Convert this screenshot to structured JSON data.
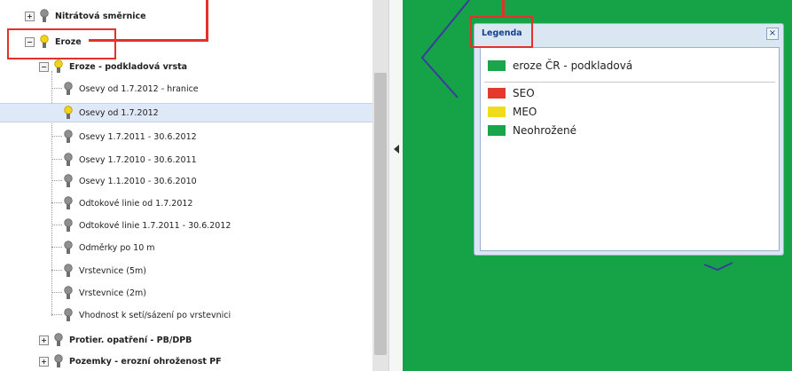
{
  "tree": {
    "items": [
      {
        "label": "Nitrátová směrnice",
        "bold": true,
        "toggle": "+",
        "bulb": "gray",
        "level": 0
      },
      {
        "label": "Eroze",
        "bold": true,
        "toggle": "−",
        "bulb": "yellow",
        "level": 0
      },
      {
        "label": "Eroze - podkladová vrsta",
        "bold": true,
        "toggle": "−",
        "bulb": "yellow",
        "level": 1
      },
      {
        "label": "Osevy od 1.7.2012 - hranice",
        "bold": false,
        "bulb": "gray",
        "level": 2
      },
      {
        "label": "Osevy od 1.7.2012",
        "bold": false,
        "bulb": "yellow",
        "level": 2,
        "selected": true
      },
      {
        "label": "Osevy 1.7.2011 - 30.6.2012",
        "bold": false,
        "bulb": "gray",
        "level": 2
      },
      {
        "label": "Osevy 1.7.2010 - 30.6.2011",
        "bold": false,
        "bulb": "gray",
        "level": 2
      },
      {
        "label": "Osevy 1.1.2010 - 30.6.2010",
        "bold": false,
        "bulb": "gray",
        "level": 2
      },
      {
        "label": "Odtokové linie od 1.7.2012",
        "bold": false,
        "bulb": "gray",
        "level": 2
      },
      {
        "label": "Odtokové linie 1.7.2011 - 30.6.2012",
        "bold": false,
        "bulb": "gray",
        "level": 2
      },
      {
        "label": "Odměrky po 10 m",
        "bold": false,
        "bulb": "gray",
        "level": 2
      },
      {
        "label": "Vrstevnice (5m)",
        "bold": false,
        "bulb": "gray",
        "level": 2
      },
      {
        "label": "Vrstevnice (2m)",
        "bold": false,
        "bulb": "gray",
        "level": 2
      },
      {
        "label": "Vhodnost k setí/sázení po vrstevnici",
        "bold": false,
        "bulb": "gray",
        "level": 2
      },
      {
        "label": "Protier. opatření - PB/DPB",
        "bold": true,
        "toggle": "+",
        "bulb": "gray",
        "level": 1
      },
      {
        "label": "Pozemky - erozní ohroženost PF",
        "bold": true,
        "toggle": "+",
        "bulb": "gray",
        "level": 1
      }
    ]
  },
  "legend": {
    "title": "Legenda",
    "close": "×",
    "layer": {
      "label": "eroze ČR - podkladová",
      "color": "#1aa54a"
    },
    "classes": [
      {
        "label": "SEO",
        "color": "#e23b2e"
      },
      {
        "label": "MEO",
        "color": "#f0dc1c"
      },
      {
        "label": "Neohrožené",
        "color": "#1aa54a"
      }
    ]
  },
  "colors": {
    "map": "#16a247",
    "parcel_outline": "#3b3ba0",
    "annotation": "#e2322a",
    "selection": "#dfe8f6"
  }
}
